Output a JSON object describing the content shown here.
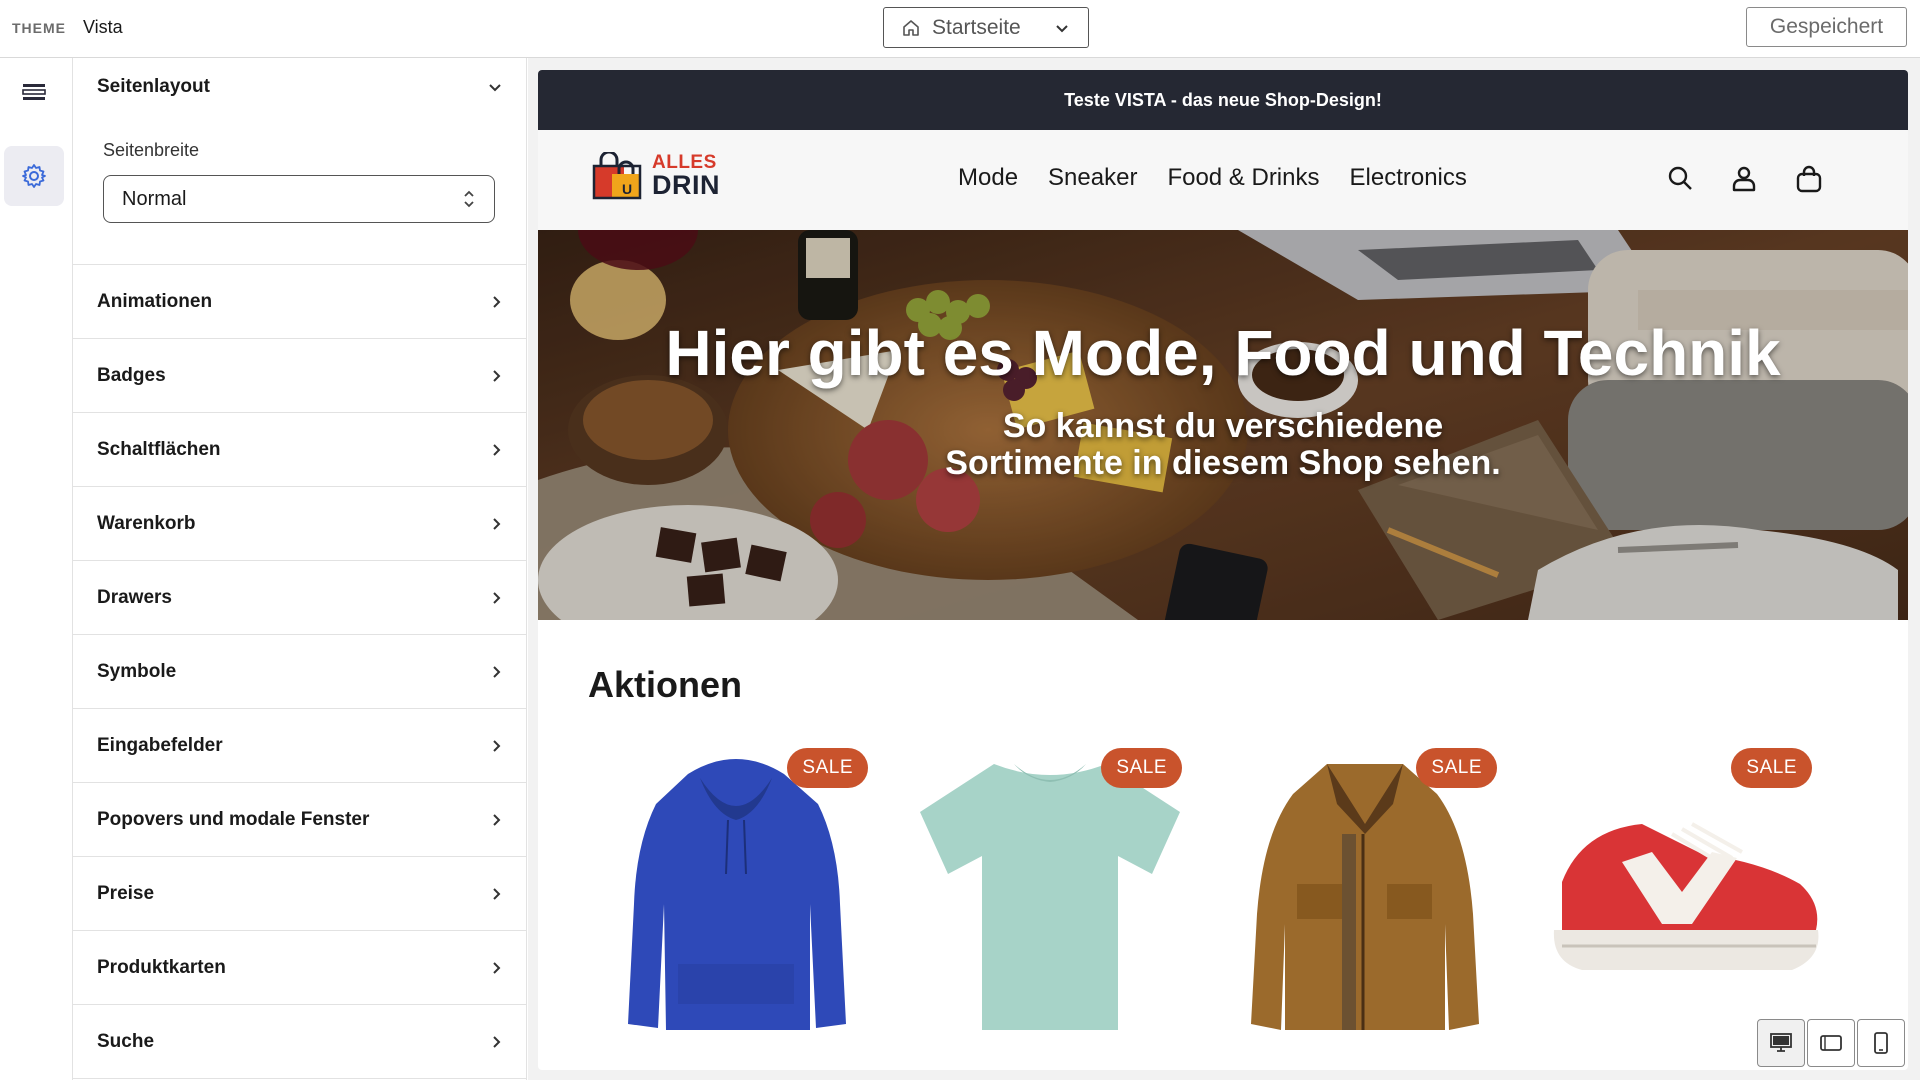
{
  "topbar": {
    "theme_label": "THEME",
    "theme_name": "Vista",
    "page_select": "Startseite",
    "saved_label": "Gespeichert"
  },
  "rail": {
    "items": [
      {
        "icon": "sections-icon",
        "active": false
      },
      {
        "icon": "gear-icon",
        "active": true
      }
    ]
  },
  "panel": {
    "expanded_section": {
      "title": "Seitenlayout",
      "field_label": "Seitenbreite",
      "field_value": "Normal"
    },
    "sections": [
      {
        "label": "Animationen"
      },
      {
        "label": "Badges"
      },
      {
        "label": "Schaltflächen"
      },
      {
        "label": "Warenkorb"
      },
      {
        "label": "Drawers"
      },
      {
        "label": "Symbole"
      },
      {
        "label": "Eingabefelder"
      },
      {
        "label": "Popovers und modale Fenster"
      },
      {
        "label": "Preise"
      },
      {
        "label": "Produktkarten"
      },
      {
        "label": "Suche"
      }
    ]
  },
  "preview": {
    "announcement": "Teste VISTA - das neue Shop-Design!",
    "logo_top": "ALLES",
    "logo_bottom": "DRIN",
    "nav": [
      "Mode",
      "Sneaker",
      "Food & Drinks",
      "Electronics"
    ],
    "header_icons": [
      "search-icon",
      "account-icon",
      "cart-bag-icon"
    ],
    "hero_title": "Hier gibt es Mode, Food und Technik",
    "hero_subtitle_line1": "So kannst du verschiedene",
    "hero_subtitle_line2": "Sortimente in diesem Shop sehen.",
    "section_title": "Aktionen",
    "products": [
      {
        "badge": "SALE",
        "kind": "blue-hoodie"
      },
      {
        "badge": "SALE",
        "kind": "mint-tshirt"
      },
      {
        "badge": "SALE",
        "kind": "brown-jacket"
      },
      {
        "badge": "SALE",
        "kind": "red-sneaker"
      }
    ]
  },
  "device_bar": {
    "modes": [
      "desktop",
      "tablet",
      "mobile"
    ],
    "active": "desktop"
  },
  "colors": {
    "announcement_bg": "#252833",
    "sale_badge": "#c9532c",
    "accent_blue": "#3b6ad9",
    "logo_red": "#d63a2a"
  }
}
